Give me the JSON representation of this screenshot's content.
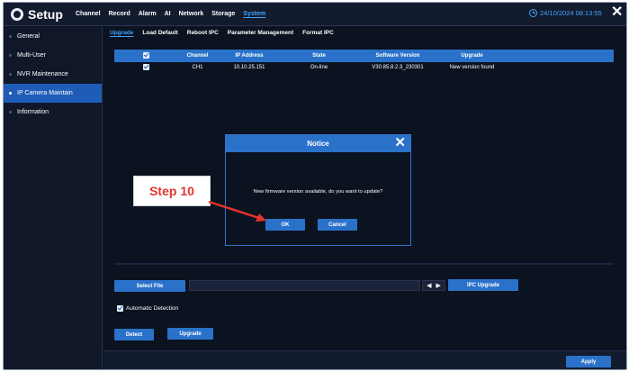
{
  "app": {
    "title": "Setup"
  },
  "topnav": [
    "Channel",
    "Record",
    "Alarm",
    "AI",
    "Network",
    "Storage",
    "System"
  ],
  "topnav_active": "System",
  "datetime": "24/10/2024 08:13:55",
  "sidebar": {
    "items": [
      {
        "label": "General"
      },
      {
        "label": "Multi-User"
      },
      {
        "label": "NVR Maintenance"
      },
      {
        "label": "IP Camera Maintain"
      },
      {
        "label": "Information"
      }
    ]
  },
  "subtabs": [
    "Upgrade",
    "Load Default",
    "Reboot IPC",
    "Parameter Management",
    "Format IPC"
  ],
  "table": {
    "headers": [
      "",
      "Channel",
      "IP Address",
      "State",
      "Software Version",
      "Upgrade",
      ""
    ],
    "rows": [
      {
        "checked": true,
        "channel": "CH1",
        "ip": "10.10.25.151",
        "state": "On-line",
        "version": "V30.85.8.2.3_230301",
        "upgrade": "New version found"
      }
    ]
  },
  "lower": {
    "select_file_label": "Select File",
    "ipc_upgrade_label": "IPC Upgrade",
    "auto_detect_label": "Automatic Detection",
    "auto_detect_checked": true,
    "detect_label": "Detect",
    "upgrade_label": "Upgrade"
  },
  "footer": {
    "apply_label": "Apply"
  },
  "dialog": {
    "title": "Notice",
    "message": "New firmware version available, do you want to update?",
    "ok_label": "OK",
    "cancel_label": "Cancel"
  },
  "annotation": {
    "step_label": "Step 10",
    "color": "#e3342f"
  },
  "colors": {
    "accent": "#2a72c9",
    "active_text": "#3fa6ff",
    "background": "#0b1220"
  }
}
